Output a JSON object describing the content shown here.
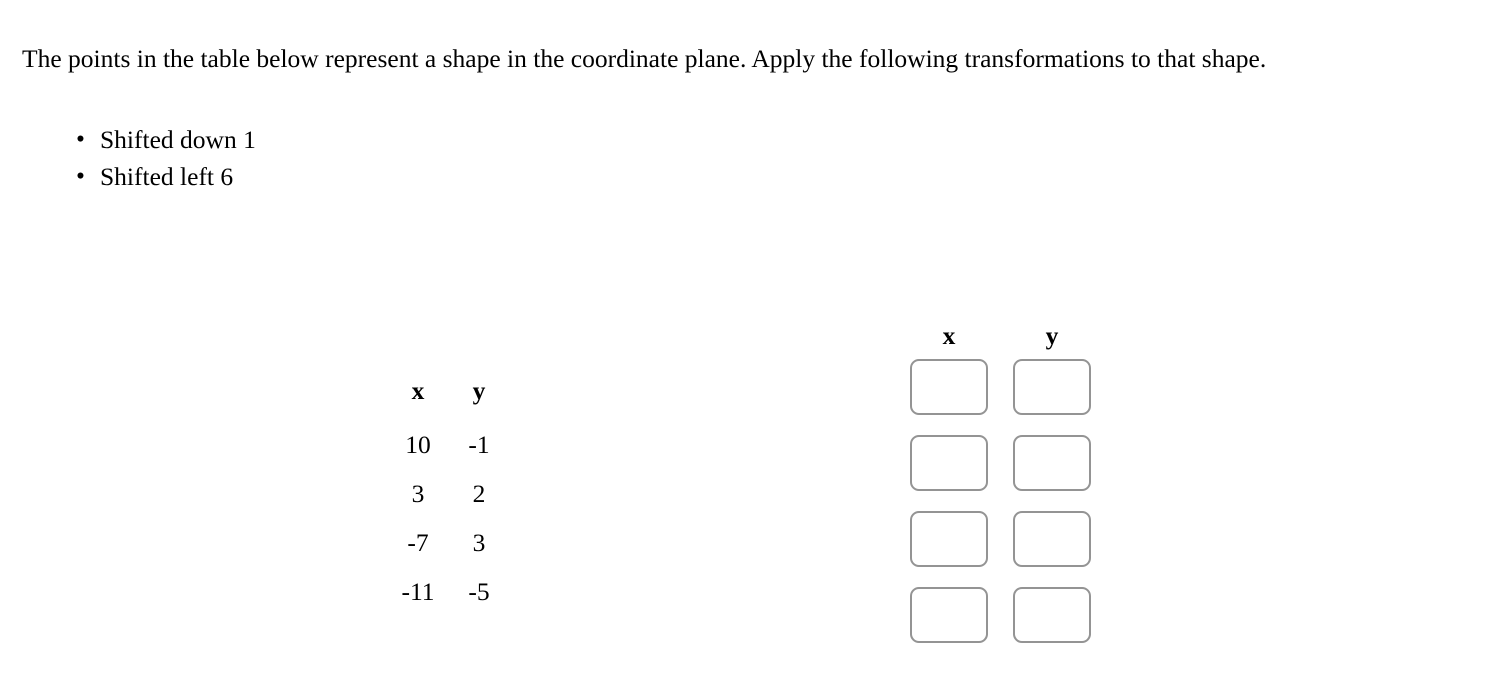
{
  "prompt": {
    "text": "The points in the table below represent a shape in the coordinate plane. Apply the following transformations to that shape."
  },
  "transformations": [
    {
      "label": "Shifted down 1"
    },
    {
      "label": "Shifted left 6"
    }
  ],
  "source_table": {
    "headers": {
      "x": "x",
      "y": "y"
    },
    "rows": [
      {
        "x": "10",
        "y": "-1"
      },
      {
        "x": "3",
        "y": "2"
      },
      {
        "x": "-7",
        "y": "3"
      },
      {
        "x": "-11",
        "y": "-5"
      }
    ]
  },
  "answer_table": {
    "headers": {
      "x": "x",
      "y": "y"
    },
    "rows": [
      {
        "x": "",
        "y": ""
      },
      {
        "x": "",
        "y": ""
      },
      {
        "x": "",
        "y": ""
      },
      {
        "x": "",
        "y": ""
      }
    ]
  },
  "colors": {
    "page_background": "#ffffff",
    "text": "#000000",
    "input_border": "#949494",
    "input_background": "#ffffff"
  }
}
